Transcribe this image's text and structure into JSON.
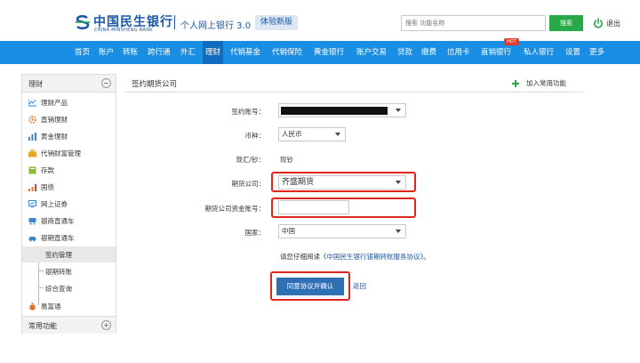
{
  "header": {
    "brand_cn": "中国民生银行",
    "brand_en": "CHINA MINSHENG BANK",
    "product": "个人网上银行 3.0",
    "trial": "体验新版",
    "search_placeholder": "搜索 功能名称",
    "search_button": "搜索",
    "logout": "退出"
  },
  "nav": {
    "items": [
      "首页",
      "账户",
      "转账",
      "跨行通",
      "外汇",
      "理财",
      "代销基金",
      "代销保险",
      "黄金银行",
      "账户交易",
      "贷款",
      "缴费",
      "信用卡",
      "直销银行",
      "私人银行",
      "设置",
      "更多"
    ],
    "active": "理财",
    "hot": "HOT"
  },
  "sidebar": {
    "title": "理财",
    "items": [
      "理财产品",
      "直销理财",
      "黄金理财",
      "代销财富管理",
      "存款",
      "国债",
      "网上证券",
      "银商直通车",
      "银期直通车"
    ],
    "sub_items": [
      "签约管理",
      "银期转账",
      "综合查询"
    ],
    "selected_sub": "签约管理",
    "extra_item": "易富通",
    "footer": "常用功能"
  },
  "panel": {
    "title": "签约期货公司",
    "add_common": "加入常用功能"
  },
  "form": {
    "account_label": "签约账号：",
    "currency_label": "币种：",
    "currency_value": "人民币",
    "cash_label": "现汇/钞：",
    "cash_value": "现钞",
    "company_label": "期货公司：",
    "company_value": "齐盛期货",
    "fund_account_label": "期货公司资金账号：",
    "fund_account_value": "",
    "country_label": "国家：",
    "country_value": "中国",
    "agreement_prefix": "请您仔细阅读",
    "agreement_link": "《中国民生银行银期转账服务协议》",
    "agreement_suffix": "。",
    "confirm": "同意协议并确认",
    "back": "返回"
  },
  "colors": {
    "nav_blue": "#1a8ee2",
    "brand_blue": "#1b57a6",
    "search_green": "#29a84a",
    "highlight_red": "#e1251b",
    "button_blue": "#2f6fb4"
  }
}
